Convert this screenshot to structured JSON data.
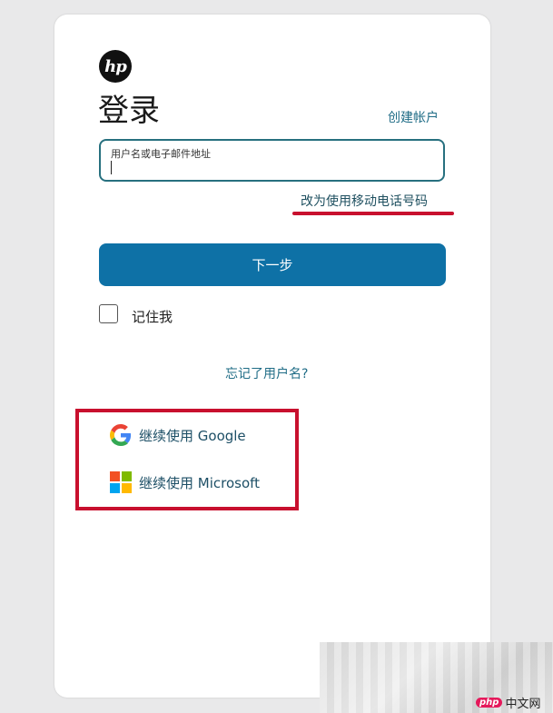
{
  "brand": {
    "logo_text": "hp"
  },
  "header": {
    "title": "登录",
    "create_account": "创建帐户"
  },
  "form": {
    "username_label": "用户名或电子邮件地址",
    "switch_to_phone": "改为使用移动电话号码",
    "next_button": "下一步",
    "remember_me": "记住我",
    "remember_checked": false,
    "forgot_username": "忘记了用户名?"
  },
  "social": {
    "google_label": "继续使用 Google",
    "microsoft_label": "继续使用 Microsoft"
  },
  "watermark": {
    "badge": "php",
    "text": "中文网"
  },
  "colors": {
    "primary_button": "#0e71a6",
    "link": "#1f6c86",
    "input_border": "#27707f",
    "annotation_red": "#c8102e"
  }
}
